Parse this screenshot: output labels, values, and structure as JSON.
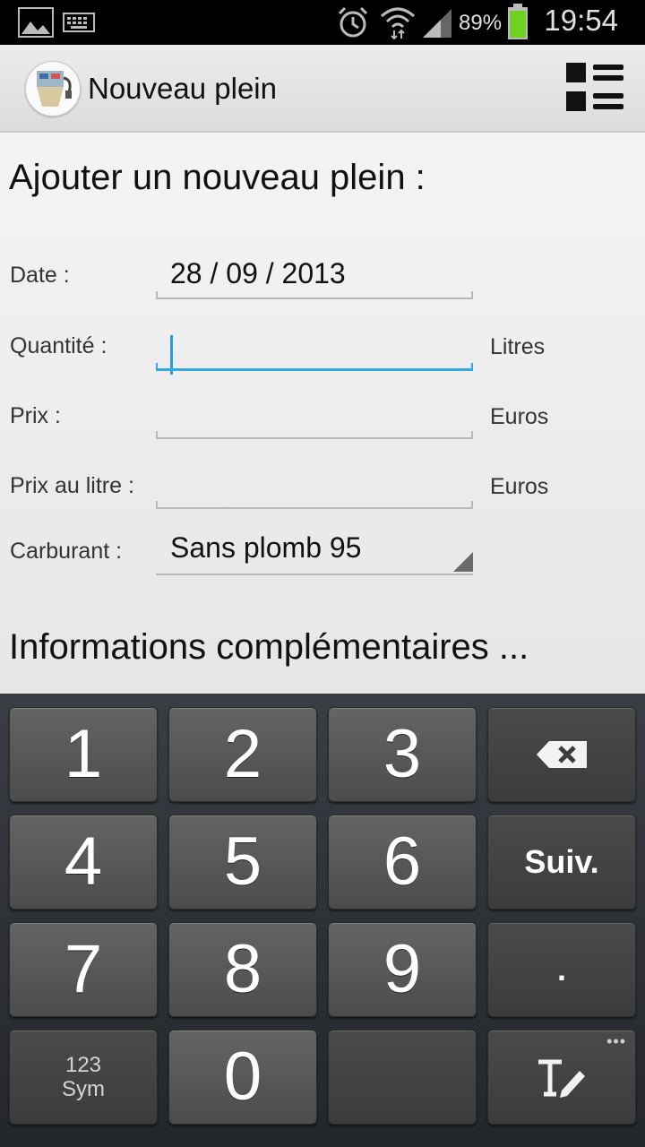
{
  "status_bar": {
    "battery_percent": "89%",
    "time": "19:54"
  },
  "action_bar": {
    "title": "Nouveau plein"
  },
  "form": {
    "heading": "Ajouter un nouveau plein :",
    "date": {
      "label": "Date :",
      "value": "28 / 09 / 2013"
    },
    "quantity": {
      "label": "Quantité :",
      "value": "",
      "unit": "Litres"
    },
    "price": {
      "label": "Prix :",
      "value": "",
      "unit": "Euros"
    },
    "price_per_litre": {
      "label": "Prix au litre :",
      "value": "",
      "unit": "Euros"
    },
    "fuel": {
      "label": "Carburant :",
      "selected": "Sans plomb 95"
    },
    "more_info": "Informations complémentaires ..."
  },
  "keyboard": {
    "k1": "1",
    "k2": "2",
    "k3": "3",
    "k4": "4",
    "k5": "5",
    "k6": "6",
    "k7": "7",
    "k8": "8",
    "k9": "9",
    "k0": "0",
    "next": "Suiv.",
    "period": ".",
    "sym_line1": "123",
    "sym_line2": "Sym",
    "more": "•••"
  }
}
